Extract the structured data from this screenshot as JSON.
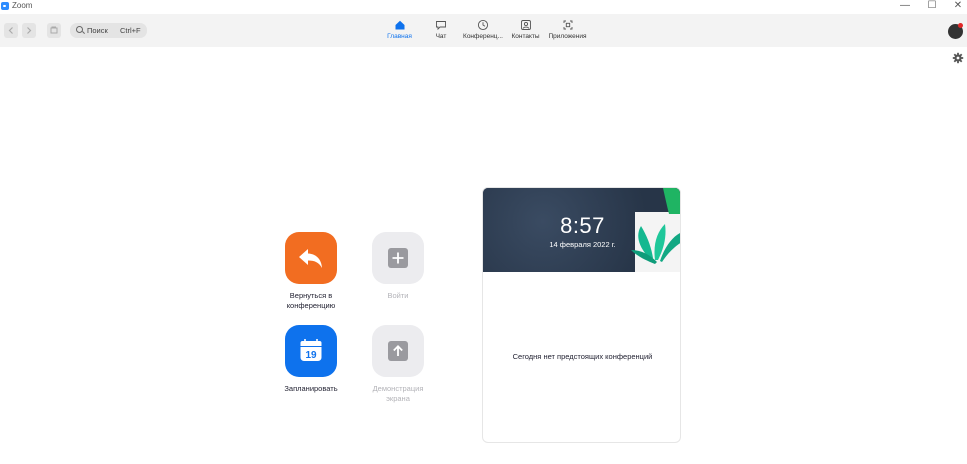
{
  "window": {
    "title": "Zoom",
    "controls": {
      "minimize": "—",
      "maximize": "☐",
      "close": "✕"
    }
  },
  "toolbar": {
    "search": {
      "label": "Поиск",
      "shortcut": "Ctrl+F"
    },
    "tabs": [
      {
        "label": "Главная",
        "icon": "home-icon",
        "active": true
      },
      {
        "label": "Чат",
        "icon": "chat-icon",
        "active": false
      },
      {
        "label": "Конференц...",
        "icon": "clock-icon",
        "active": false
      },
      {
        "label": "Контакты",
        "icon": "contacts-icon",
        "active": false
      },
      {
        "label": "Приложения",
        "icon": "apps-icon",
        "active": false
      }
    ]
  },
  "actions": {
    "return": {
      "label": "Вернуться в конференцию",
      "icon": "return-arrow-icon",
      "color": "#F26D21"
    },
    "join": {
      "label": "Войти",
      "icon": "plus-icon",
      "disabled": true
    },
    "schedule": {
      "label": "Запланировать",
      "icon": "calendar-icon",
      "day": "19",
      "color": "#0E72ED"
    },
    "share": {
      "label": "Демонстрация экрана",
      "icon": "share-up-arrow-icon",
      "disabled": true
    }
  },
  "meetings": {
    "time": "8:57",
    "date": "14 февраля 2022 г.",
    "empty_message": "Сегодня нет предстоящих конференций"
  },
  "colors": {
    "accent": "#0E72ED",
    "orange": "#F26D21",
    "notification": "#e02828"
  }
}
